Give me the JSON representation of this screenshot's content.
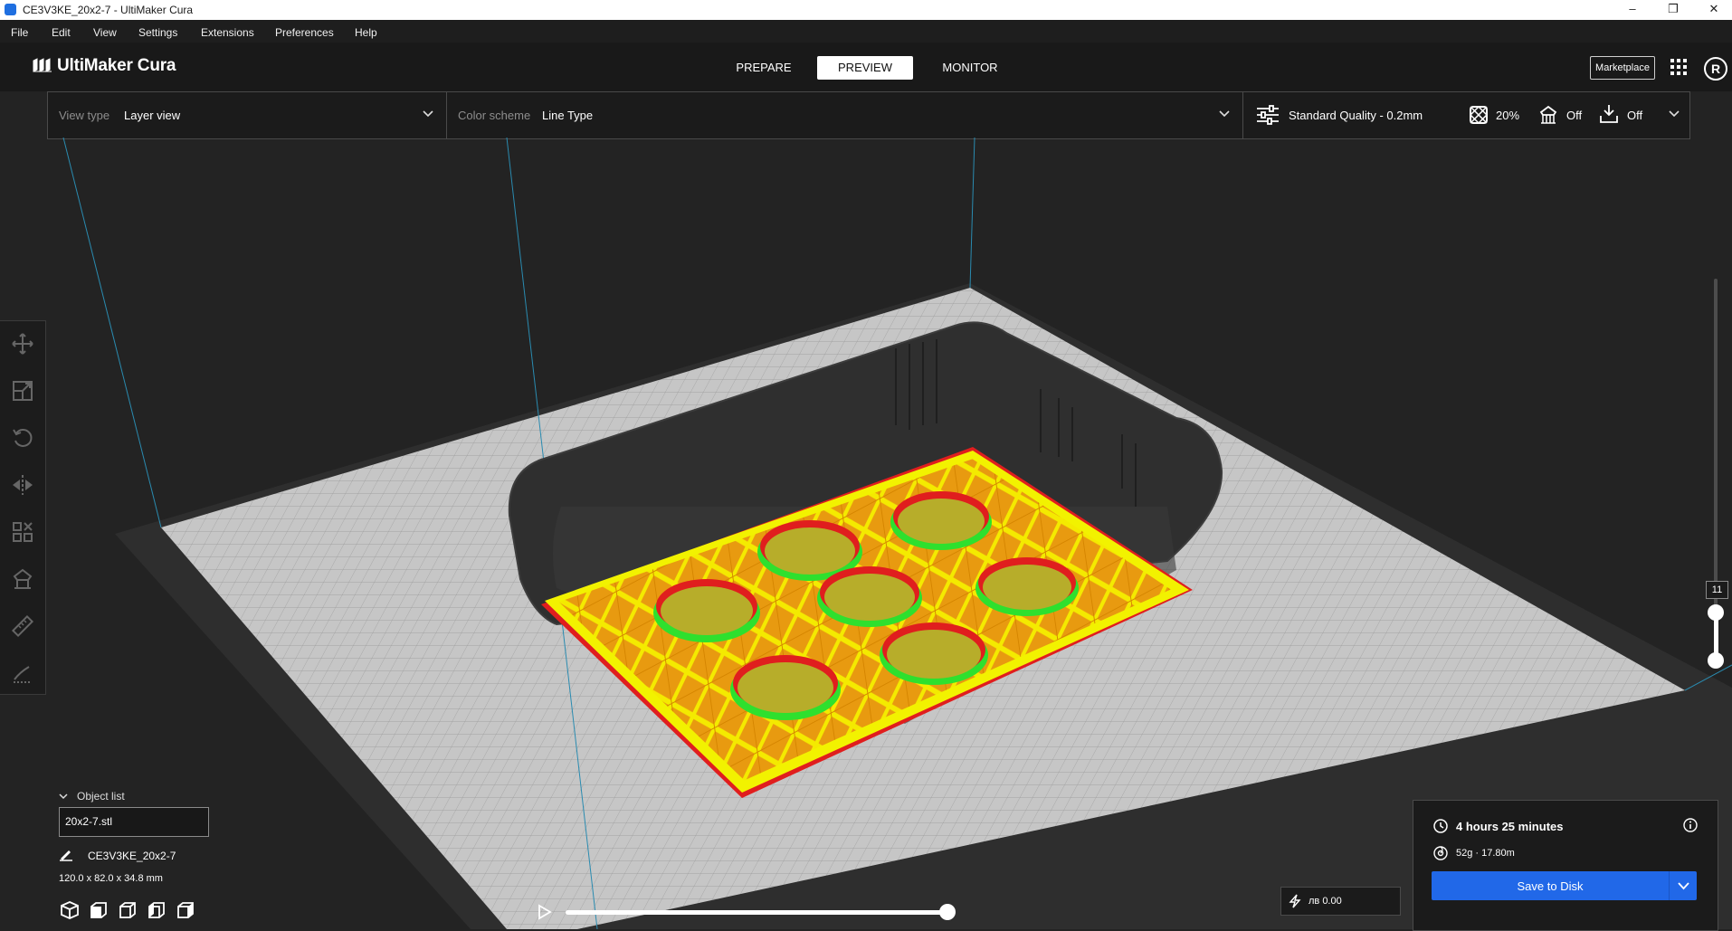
{
  "window": {
    "title": "CE3V3KE_20x2-7 - UltiMaker Cura",
    "controls": [
      "minimize",
      "restore",
      "close"
    ]
  },
  "menu": {
    "items": [
      "File",
      "Edit",
      "View",
      "Settings",
      "Extensions",
      "Preferences",
      "Help"
    ]
  },
  "header": {
    "logo": "UltiMaker Cura",
    "stages": [
      {
        "label": "PREPARE",
        "active": false
      },
      {
        "label": "PREVIEW",
        "active": true
      },
      {
        "label": "MONITOR",
        "active": false
      }
    ],
    "marketplace_label": "Marketplace",
    "account_initial": "R"
  },
  "toolbar": {
    "view_type_label": "View type",
    "view_type_value": "Layer view",
    "color_scheme_label": "Color scheme",
    "color_scheme_value": "Line Type",
    "quality": "Standard Quality - 0.2mm",
    "infill": "20%",
    "support": "Off",
    "adhesion": "Off"
  },
  "tools": {
    "items": [
      "move-tool",
      "scale-tool",
      "rotate-tool",
      "mirror-tool",
      "per-model-settings-tool",
      "support-blocker-tool",
      "measure-tool",
      "paint-tool"
    ]
  },
  "object_list": {
    "header": "Object list",
    "file": "20x2-7.stl",
    "name": "CE3V3KE_20x2-7",
    "dimensions": "120.0 x 82.0 x 34.8 mm"
  },
  "layer_slider": {
    "current_layer": "11"
  },
  "cost": {
    "value": "лв 0.00"
  },
  "print_summary": {
    "time": "4 hours 25 minutes",
    "material": "52g · 17.80m",
    "save_label": "Save to Disk"
  },
  "colors": {
    "accent": "#2168e8",
    "background": "#232323",
    "build_plate": "#c4c4c4",
    "infill": "#f0a000",
    "outer_wall": "#e01e1e",
    "inner_wall": "#2ee02e",
    "skin": "#f2f200"
  }
}
